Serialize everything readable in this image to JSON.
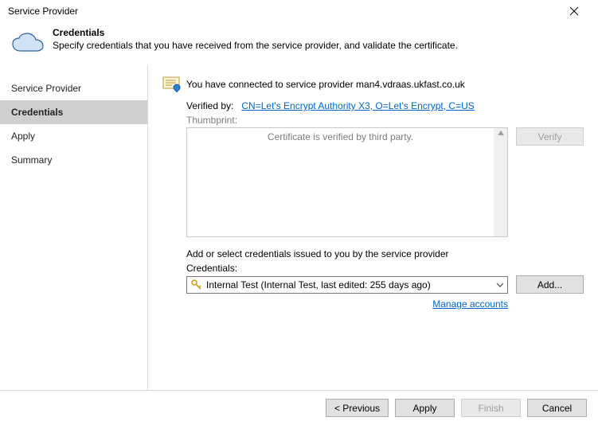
{
  "window": {
    "title": "Service Provider"
  },
  "header": {
    "heading": "Credentials",
    "subheading": "Specify credentials that you have received from the service provider, and validate the certificate."
  },
  "sidebar": {
    "items": [
      {
        "label": "Service Provider"
      },
      {
        "label": "Credentials"
      },
      {
        "label": "Apply"
      },
      {
        "label": "Summary"
      }
    ]
  },
  "content": {
    "connected_text": "You have connected to service provider man4.vdraas.ukfast.co.uk",
    "verified_label": "Verified by:",
    "verified_link": "CN=Let's Encrypt Authority X3, O=Let's Encrypt, C=US",
    "thumbprint_label": "Thumbprint:",
    "thumbprint_text": "Certificate is verified by third party.",
    "verify_btn": "Verify",
    "cred_instruction": "Add or select credentials issued to you by the service provider",
    "cred_label": "Credentials:",
    "cred_selected": "Internal Test (Internal Test, last edited: 255 days ago)",
    "add_btn": "Add...",
    "manage_link": "Manage accounts"
  },
  "footer": {
    "previous": "< Previous",
    "apply": "Apply",
    "finish": "Finish",
    "cancel": "Cancel"
  }
}
